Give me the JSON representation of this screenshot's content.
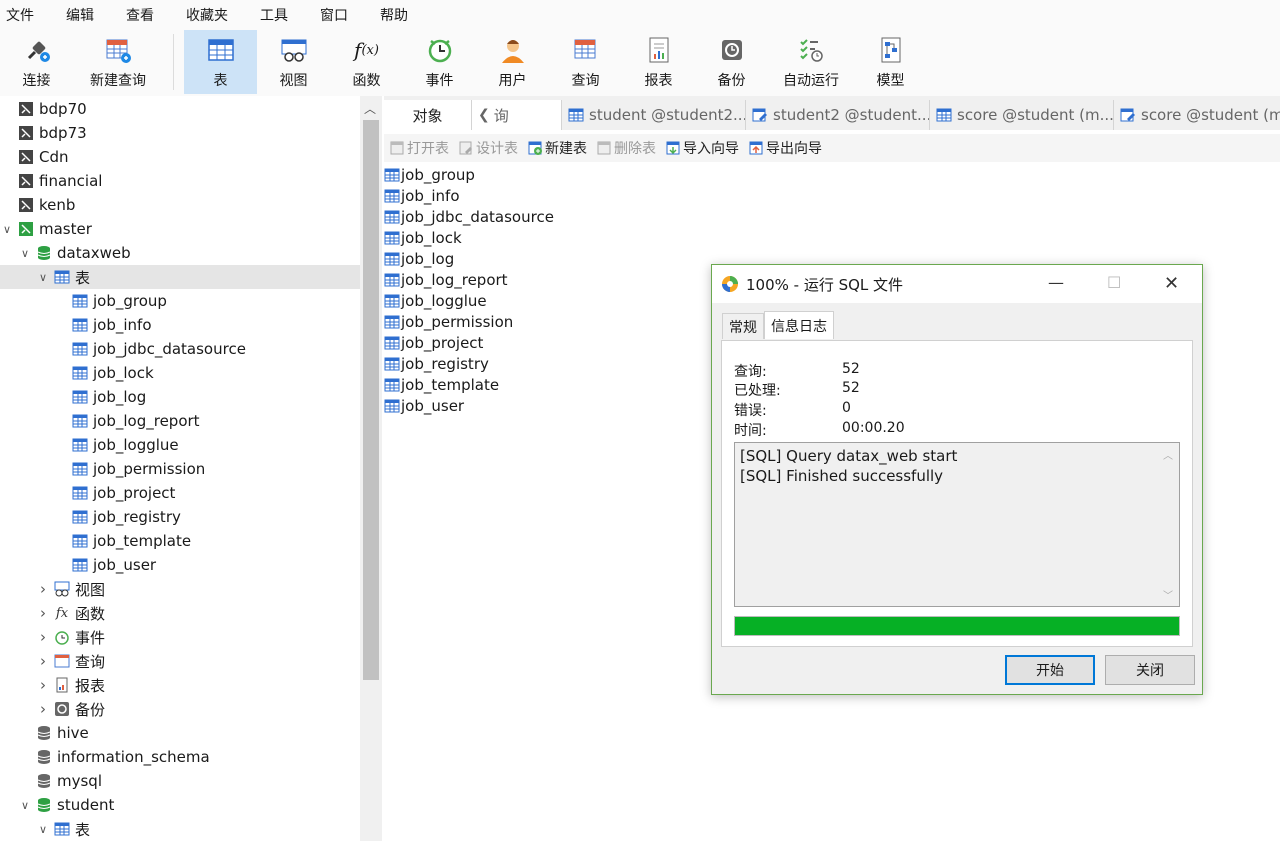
{
  "menu": [
    "文件",
    "编辑",
    "查看",
    "收藏夹",
    "工具",
    "窗口",
    "帮助"
  ],
  "toolbar": [
    {
      "label": "连接",
      "icon": "plug-icon"
    },
    {
      "label": "新建查询",
      "icon": "new-query-icon"
    },
    {
      "label": "表",
      "icon": "table-icon"
    },
    {
      "label": "视图",
      "icon": "view-icon"
    },
    {
      "label": "函数",
      "icon": "function-icon"
    },
    {
      "label": "事件",
      "icon": "event-clock-icon"
    },
    {
      "label": "用户",
      "icon": "user-icon"
    },
    {
      "label": "查询",
      "icon": "query-icon"
    },
    {
      "label": "报表",
      "icon": "report-icon"
    },
    {
      "label": "备份",
      "icon": "backup-icon"
    },
    {
      "label": "自动运行",
      "icon": "auto-run-icon"
    },
    {
      "label": "模型",
      "icon": "model-icon"
    }
  ],
  "tree": {
    "connections": [
      "bdp70",
      "bdp73",
      "Cdn",
      "financial",
      "kenb",
      "master"
    ],
    "db_dataxweb": "dataxweb",
    "tables_label": "表",
    "tables": [
      "job_group",
      "job_info",
      "job_jdbc_datasource",
      "job_lock",
      "job_log",
      "job_log_report",
      "job_logglue",
      "job_permission",
      "job_project",
      "job_registry",
      "job_template",
      "job_user"
    ],
    "groups": [
      "视图",
      "函数",
      "事件",
      "查询",
      "报表",
      "备份"
    ],
    "other_dbs": [
      "hive",
      "information_schema",
      "mysql"
    ],
    "db_student": "student"
  },
  "tabs": {
    "objects": "对象",
    "query_partial": "询",
    "items": [
      "student @student2...",
      "student2 @student...",
      "score @student (m...",
      "score @student (m..."
    ]
  },
  "objbar": [
    "打开表",
    "设计表",
    "新建表",
    "删除表",
    "导入向导",
    "导出向导"
  ],
  "dialog": {
    "title": "100% - 运行 SQL 文件",
    "tabs": [
      "常规",
      "信息日志"
    ],
    "stats": [
      {
        "k": "查询:",
        "v": "52"
      },
      {
        "k": "已处理:",
        "v": "52"
      },
      {
        "k": "错误:",
        "v": "0"
      },
      {
        "k": "时间:",
        "v": "00:00.20"
      }
    ],
    "log": [
      "[SQL] Query datax_web start",
      "[SQL] Finished successfully"
    ],
    "progress": 1.0,
    "start_btn": "开始",
    "close_btn": "关闭",
    "progress_color": "#06b025"
  }
}
